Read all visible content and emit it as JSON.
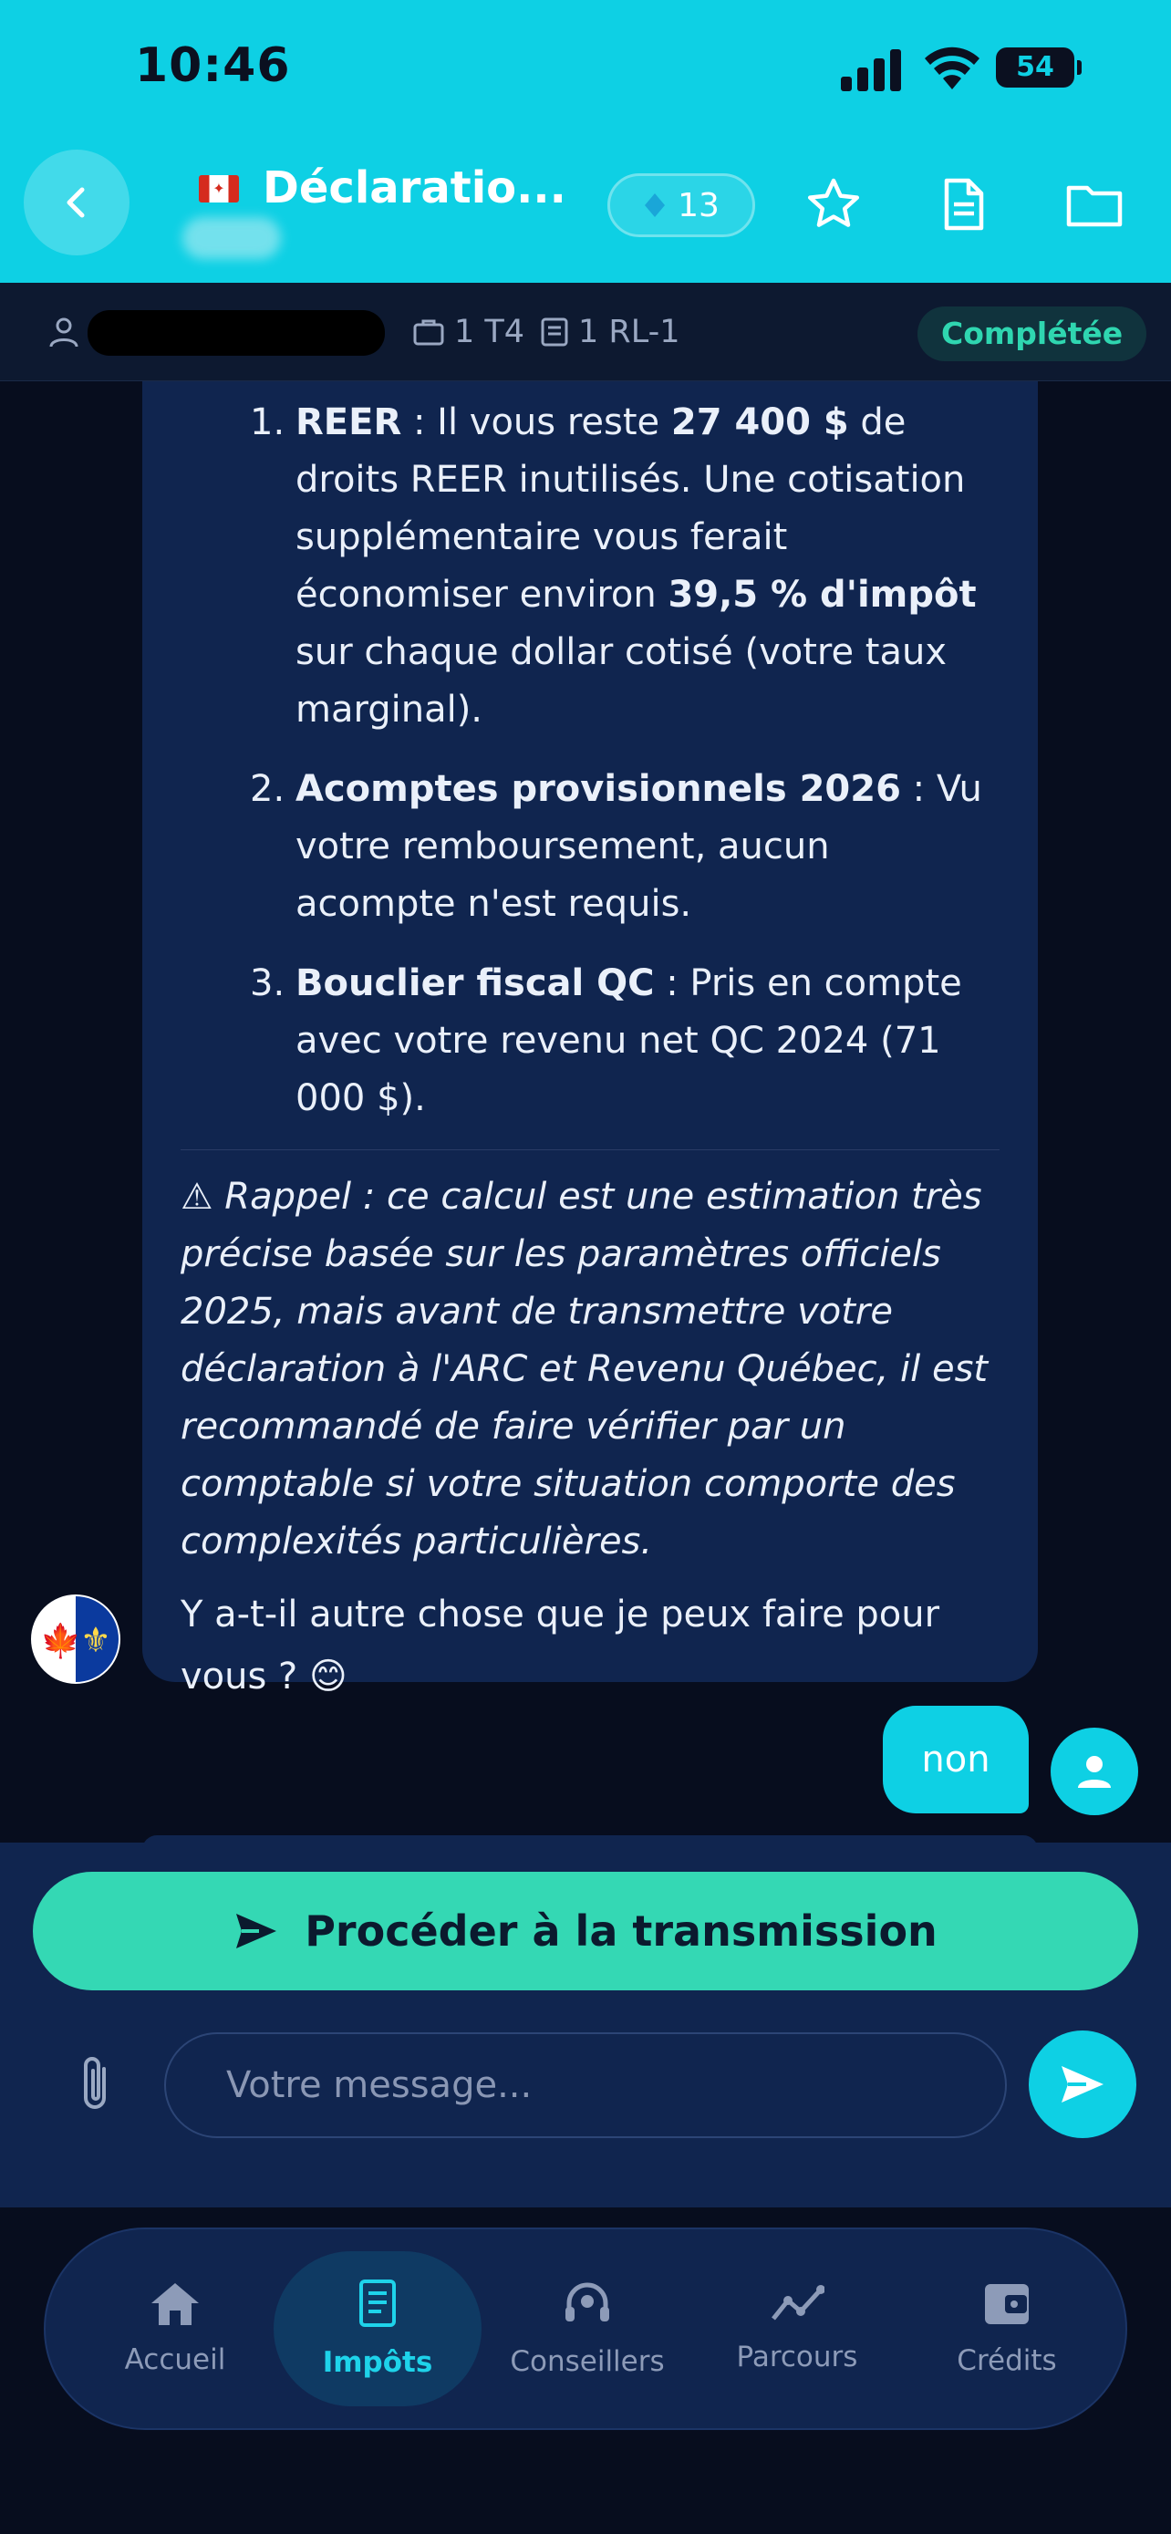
{
  "status_bar": {
    "time": "10:46",
    "battery": "54"
  },
  "header": {
    "title": "Déclaratio...",
    "credits": "13"
  },
  "info_bar": {
    "t4": "1 T4",
    "rl1": "1 RL-1",
    "status": "Complétée"
  },
  "chat": {
    "assistant": {
      "items": [
        {
          "number": "1.",
          "parts": [
            {
              "text": "REER",
              "bold": true
            },
            {
              "text": " : Il vous reste ",
              "bold": false
            },
            {
              "text": "27 400 $",
              "bold": true
            },
            {
              "text": " de droits REER inutilisés. Une cotisation supplémentaire vous ferait économiser environ ",
              "bold": false
            },
            {
              "text": "39,5 % d'impôt",
              "bold": true
            },
            {
              "text": " sur chaque dollar cotisé (votre taux marginal).",
              "bold": false
            }
          ]
        },
        {
          "number": "2.",
          "parts": [
            {
              "text": "Acomptes provisionnels 2026",
              "bold": true
            },
            {
              "text": " : Vu votre remboursement, aucun acompte n'est requis.",
              "bold": false
            }
          ]
        },
        {
          "number": "3.",
          "parts": [
            {
              "text": "Bouclier fiscal QC",
              "bold": true
            },
            {
              "text": " : Pris en compte avec votre revenu net QC 2024 (71 000 $).",
              "bold": false
            }
          ]
        }
      ],
      "warning": "⚠ Rappel : ce calcul est une estimation très précise basée sur les paramètres officiels 2025, mais avant de transmettre votre déclaration à l'ARC et Revenu Québec, il est recommandé de faire vérifier par un comptable si votre situation comporte des complexités particulières.",
      "question": "Y a-t-il autre chose que je peux faire pour vous ? 😊"
    },
    "user_message": "non"
  },
  "composer": {
    "proceed_label": "Procéder à la transmission",
    "placeholder": "Votre message..."
  },
  "nav": {
    "items": [
      {
        "label": "Accueil",
        "icon": "home-icon",
        "active": false
      },
      {
        "label": "Impôts",
        "icon": "receipt-icon",
        "active": true
      },
      {
        "label": "Conseillers",
        "icon": "headset-icon",
        "active": false
      },
      {
        "label": "Parcours",
        "icon": "trend-icon",
        "active": false
      },
      {
        "label": "Crédits",
        "icon": "wallet-icon",
        "active": false
      }
    ]
  },
  "colors": {
    "accent_cyan": "#0ed0e4",
    "accent_green": "#34d8b4",
    "bubble_bg": "#10254f",
    "page_bg": "#070d1e"
  }
}
